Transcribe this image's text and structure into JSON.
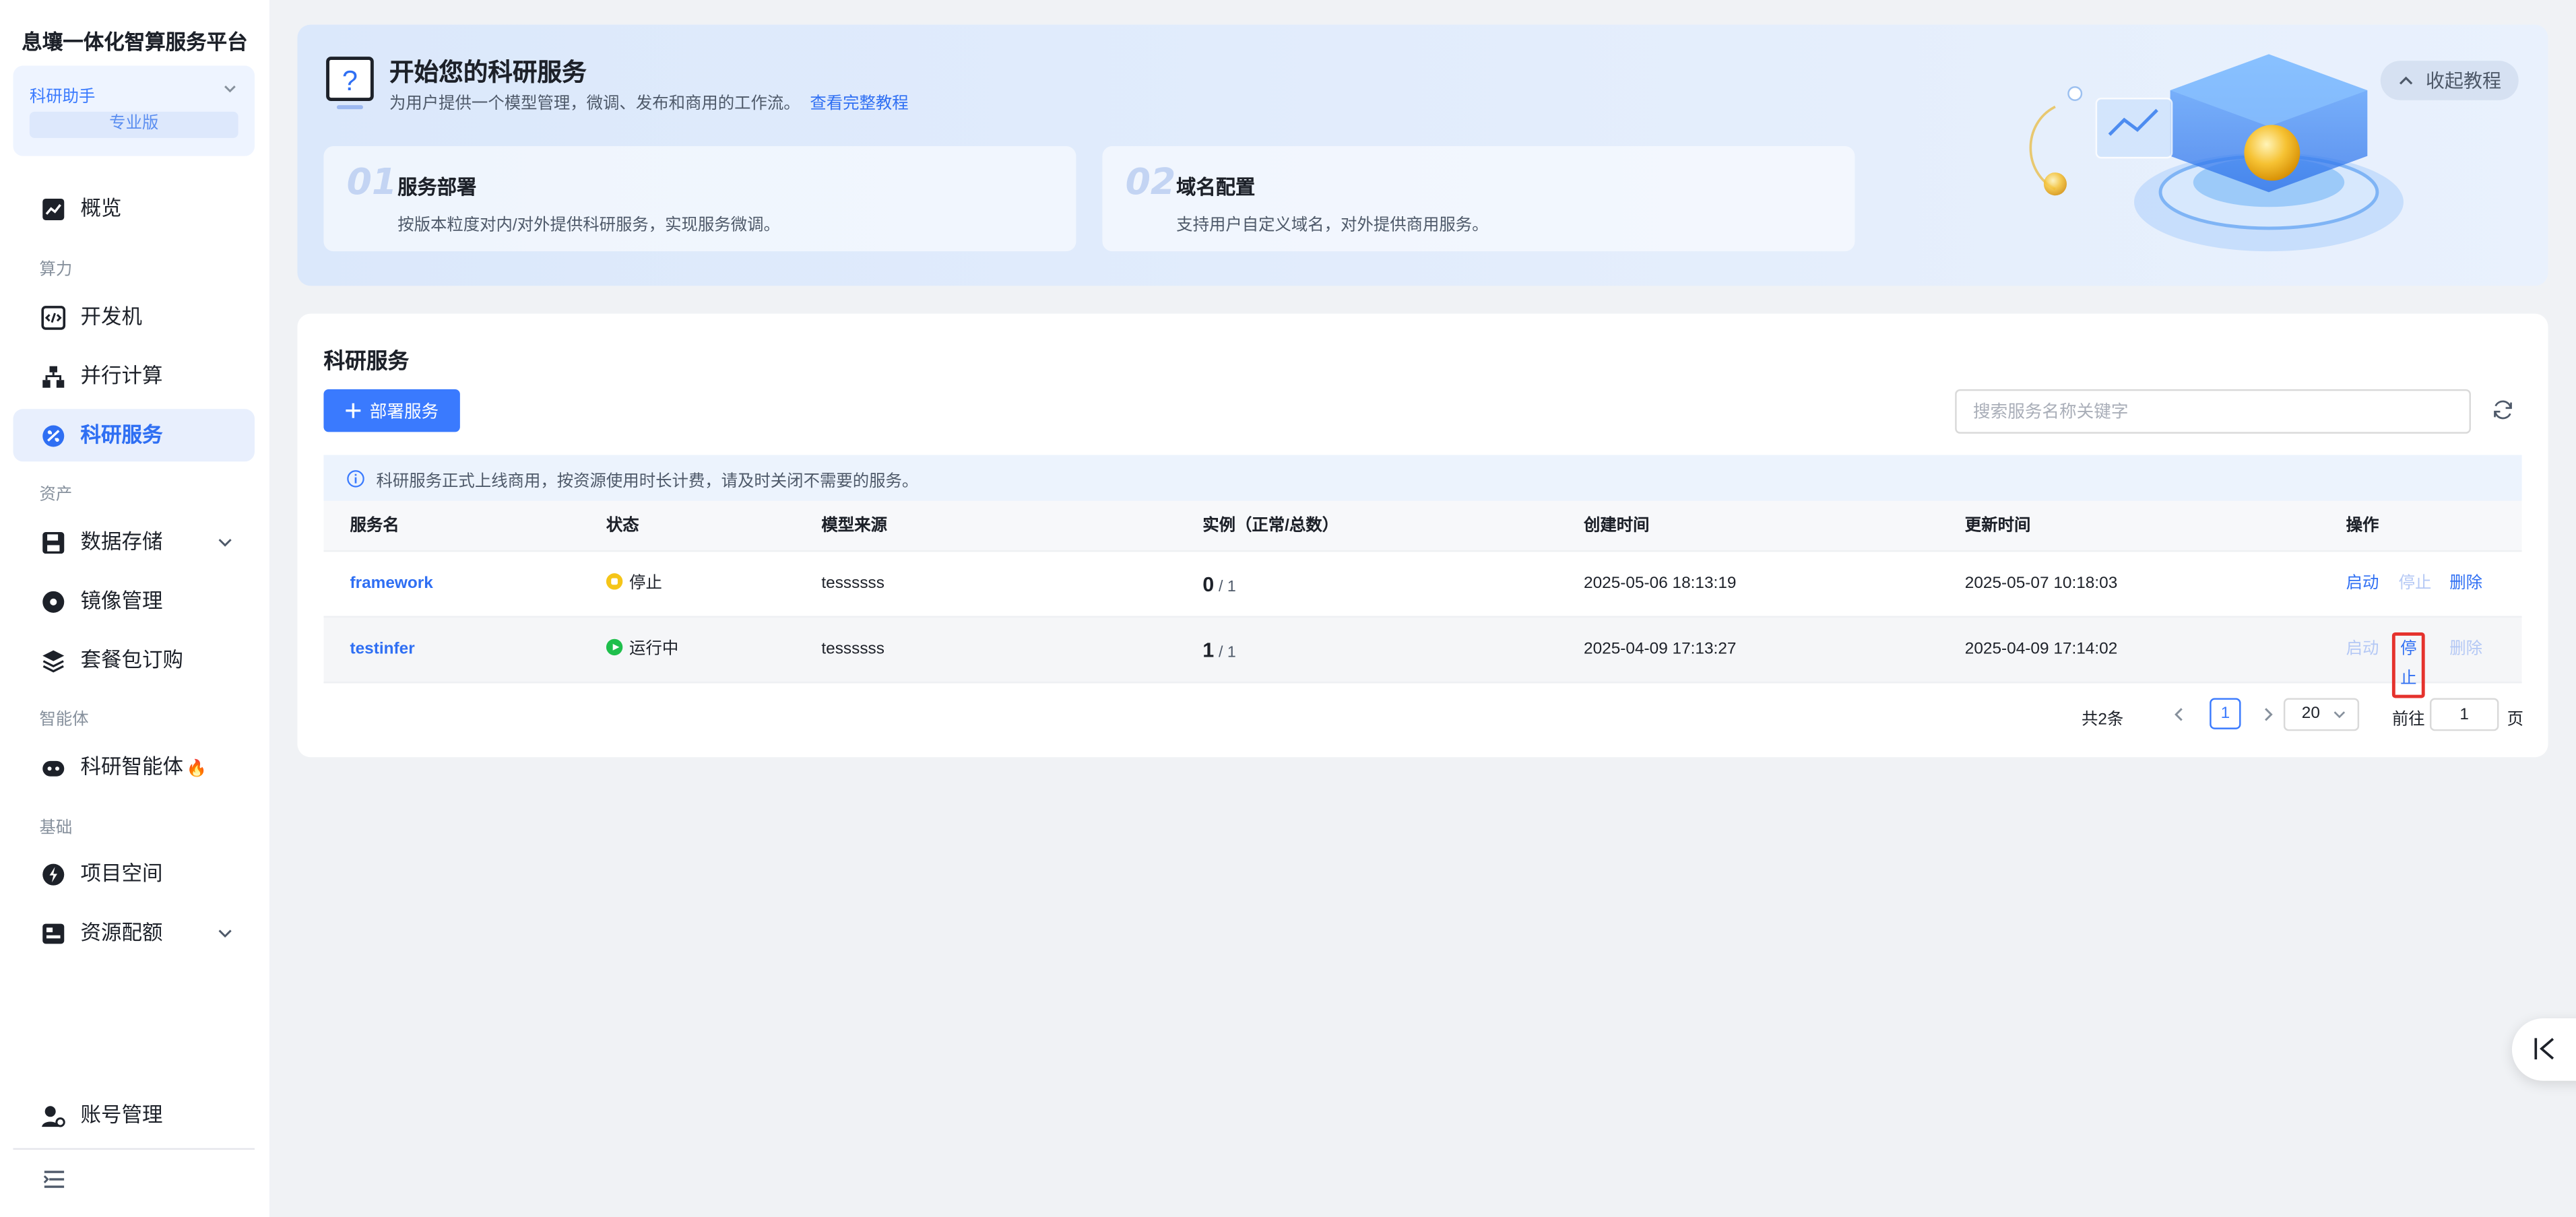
{
  "sidebar": {
    "brand": "息壤一体化智算服务平台",
    "assistant": {
      "name": "科研助手",
      "edition": "专业版"
    },
    "overview": "概览",
    "groups": {
      "compute": "算力",
      "assets": "资产",
      "agent": "智能体",
      "base": "基础"
    },
    "items": {
      "dev_machine": "开发机",
      "parallel": "并行计算",
      "research_service": "科研服务",
      "data_storage": "数据存储",
      "image_mgmt": "镜像管理",
      "package": "套餐包订购",
      "agent": "科研智能体",
      "project": "项目空间",
      "quota": "资源配额",
      "account": "账号管理"
    }
  },
  "banner": {
    "title": "开始您的科研服务",
    "subtitle": "为用户提供一个模型管理，微调、发布和商用的工作流。",
    "link": "查看完整教程",
    "collapse": "收起教程",
    "steps": [
      {
        "num": "01",
        "title": "服务部署",
        "desc": "按版本粒度对内/对外提供科研服务，实现服务微调。"
      },
      {
        "num": "02",
        "title": "域名配置",
        "desc": "支持用户自定义域名，对外提供商用服务。"
      }
    ]
  },
  "main": {
    "title": "科研服务",
    "deploy_label": "部署服务",
    "search_placeholder": "搜索服务名称关键字",
    "notice": "科研服务正式上线商用，按资源使用时长计费，请及时关闭不需要的服务。",
    "columns": {
      "name": "服务名",
      "status": "状态",
      "model": "模型来源",
      "instances": "实例（正常/总数）",
      "created": "创建时间",
      "updated": "更新时间",
      "ops": "操作"
    },
    "rows": [
      {
        "name": "framework",
        "status": "停止",
        "model": "tessssss",
        "inst_ok": "0",
        "inst_total": "/ 1",
        "created": "2025-05-06 18:13:19",
        "updated": "2025-05-07 10:18:03",
        "op_start": "启动",
        "op_stop": "停止",
        "op_delete": "删除"
      },
      {
        "name": "testinfer",
        "status": "运行中",
        "model": "tessssss",
        "inst_ok": "1",
        "inst_total": "/ 1",
        "created": "2025-04-09 17:13:27",
        "updated": "2025-04-09 17:14:02",
        "op_start": "启动",
        "op_stop": "停止",
        "op_delete": "删除"
      }
    ],
    "pagination": {
      "total": "共2条",
      "page": "1",
      "page_size": "20",
      "goto": "前往",
      "goto_value": "1",
      "suffix": "页"
    }
  },
  "colors": {
    "accent": "#3a7afe",
    "highlight": "#e5322d",
    "running": "#1fbf4c",
    "stopped": "#f5c518"
  }
}
